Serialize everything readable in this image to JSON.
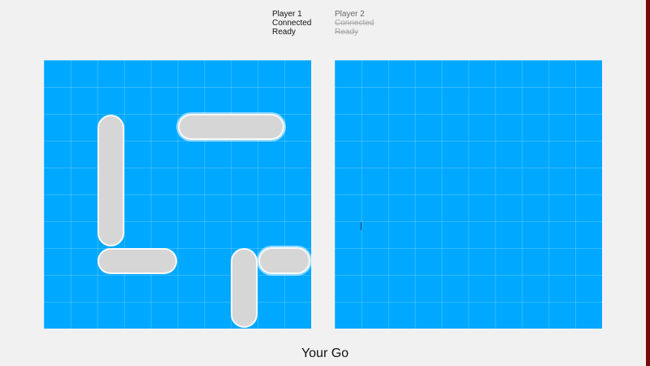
{
  "status": {
    "player1": {
      "name": "Player 1",
      "connection": "Connected",
      "ready": "Ready"
    },
    "player2": {
      "name": "Player 2",
      "connection": "Connected",
      "ready": "Ready"
    }
  },
  "colors": {
    "background": "#f1f1f1",
    "board": "#00a8ff",
    "ship": "#d6d6d6",
    "edge": "#7a0b0b"
  },
  "turn": {
    "text": "Your Go"
  }
}
